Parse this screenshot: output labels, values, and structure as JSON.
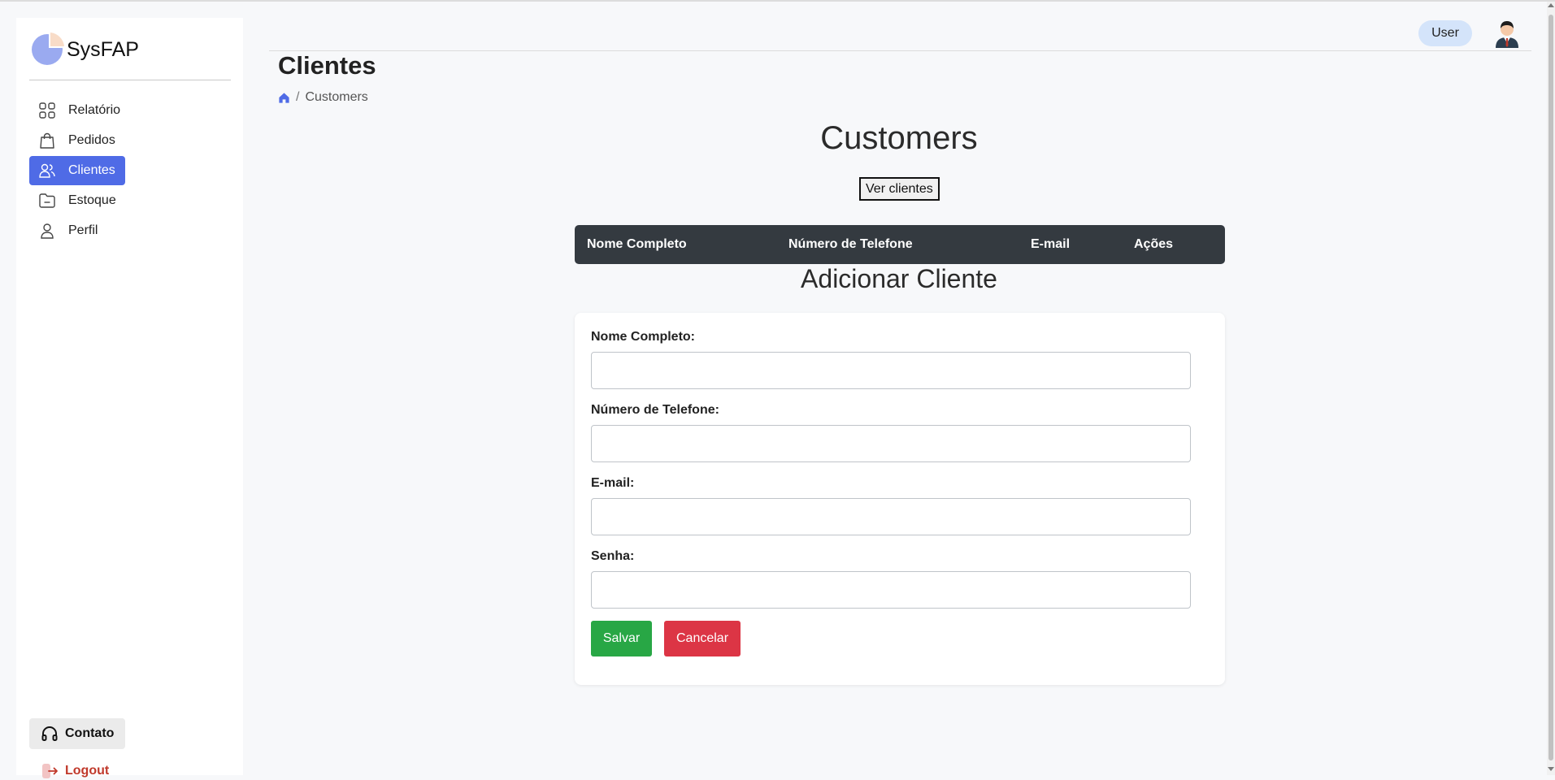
{
  "app": {
    "name": "SysFAP"
  },
  "sidebar": {
    "items": [
      {
        "label": "Relatório",
        "icon": "grid-icon",
        "active": false
      },
      {
        "label": "Pedidos",
        "icon": "shopping-bag-icon",
        "active": false
      },
      {
        "label": "Clientes",
        "icon": "users-icon",
        "active": true
      },
      {
        "label": "Estoque",
        "icon": "folder-icon",
        "active": false
      },
      {
        "label": "Perfil",
        "icon": "user-icon",
        "active": false
      }
    ],
    "contact_label": "Contato",
    "logout_label": "Logout"
  },
  "header": {
    "user_label": "User"
  },
  "page": {
    "title": "Clientes",
    "breadcrumb": {
      "current": "Customers"
    }
  },
  "main": {
    "heading": "Customers",
    "view_button": "Ver clientes",
    "table": {
      "headers": [
        "Nome Completo",
        "Número de Telefone",
        "E-mail",
        "Ações"
      ]
    },
    "form": {
      "heading": "Adicionar Cliente",
      "fields": [
        {
          "label": "Nome Completo:",
          "value": ""
        },
        {
          "label": "Número de Telefone:",
          "value": ""
        },
        {
          "label": "E-mail:",
          "value": ""
        },
        {
          "label": "Senha:",
          "value": ""
        }
      ],
      "save_label": "Salvar",
      "cancel_label": "Cancelar"
    }
  },
  "colors": {
    "accent": "#4f6be6",
    "table_header": "#343a40",
    "save": "#28a745",
    "cancel": "#dc3545",
    "logout": "#c0392b",
    "user_pill": "#d4e4fa"
  }
}
